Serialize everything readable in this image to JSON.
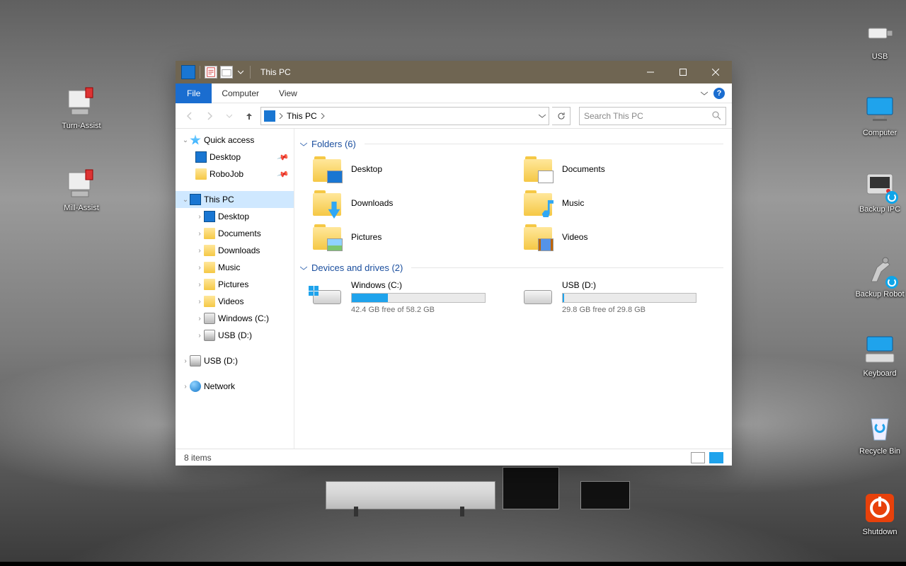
{
  "desktopIcons": {
    "turn": "Turn-Assist",
    "mill": "Mill-Assist",
    "usb": "USB",
    "comp": "Computer",
    "bipc": "Backup IPC",
    "brob": "Backup Robot",
    "keyb": "Keyboard",
    "recyc": "Recycle Bin",
    "shut": "Shutdown"
  },
  "window": {
    "title": "This PC",
    "menus": {
      "file": "File",
      "computer": "Computer",
      "view": "View"
    },
    "breadcrumb": "This PC",
    "searchPlaceholder": "Search This PC",
    "nav": {
      "quick": "Quick access",
      "desktop": "Desktop",
      "robojob": "RoboJob",
      "thispc": "This PC",
      "docs": "Documents",
      "dls": "Downloads",
      "music": "Music",
      "pics": "Pictures",
      "videos": "Videos",
      "winc": "Windows (C:)",
      "usbd": "USB (D:)",
      "usbd2": "USB (D:)",
      "net": "Network"
    },
    "groups": {
      "folders": "Folders (6)",
      "drives": "Devices and drives (2)"
    },
    "folders": [
      {
        "name": "Desktop",
        "ov": "ov-mon"
      },
      {
        "name": "Documents",
        "ov": "ov-doc"
      },
      {
        "name": "Downloads",
        "ov": "ov-dl"
      },
      {
        "name": "Music",
        "ov": "ov-mus"
      },
      {
        "name": "Pictures",
        "ov": "ov-pic"
      },
      {
        "name": "Videos",
        "ov": "ov-vid"
      }
    ],
    "drives": [
      {
        "name": "Windows (C:)",
        "free": "42.4 GB free of 58.2 GB",
        "pct": 27,
        "win": true
      },
      {
        "name": "USB (D:)",
        "free": "29.8 GB free of 29.8 GB",
        "pct": 1,
        "win": false
      }
    ],
    "status": "8 items"
  }
}
